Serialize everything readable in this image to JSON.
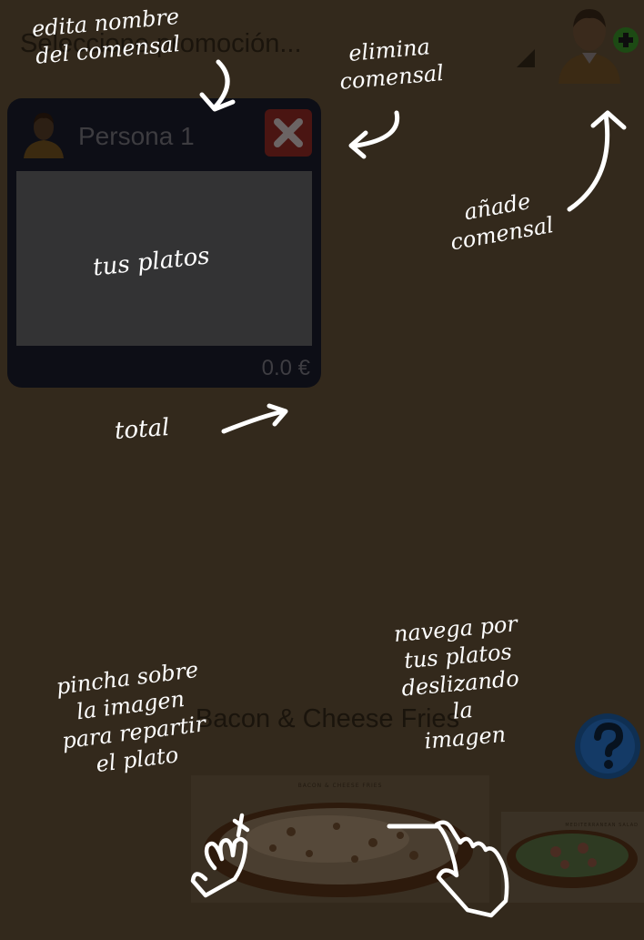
{
  "promotion_select": {
    "value": "Seleccione promoción..."
  },
  "diner_card": {
    "name": "Persona 1",
    "total": "0.0 €"
  },
  "dish": {
    "title": "Bacon & Cheese Fries",
    "image_caption": "BACON & CHEESE FRIES",
    "next_image_caption": "MEDITERRANEAN SALAD"
  },
  "help": {
    "icon": "help-icon"
  },
  "annotations": {
    "edit_name": [
      "edita nombre",
      "del comensal"
    ],
    "remove_diner": [
      "elimina",
      "comensal"
    ],
    "add_diner": [
      "añade",
      "comensal"
    ],
    "your_dishes": "tus platos",
    "total": "total",
    "tap_image": [
      "pincha sobre",
      "la imagen",
      "para repartir",
      "el plato"
    ],
    "swipe": [
      "navega por",
      "tus platos",
      "deslizando",
      "la",
      "imagen"
    ]
  },
  "colors": {
    "overlay_bg": "#33291c",
    "card_bg": "#0d0e16",
    "add_green": "#1d4a14",
    "remove_red": "#4a1512",
    "help_blue": "#0f2f52"
  }
}
